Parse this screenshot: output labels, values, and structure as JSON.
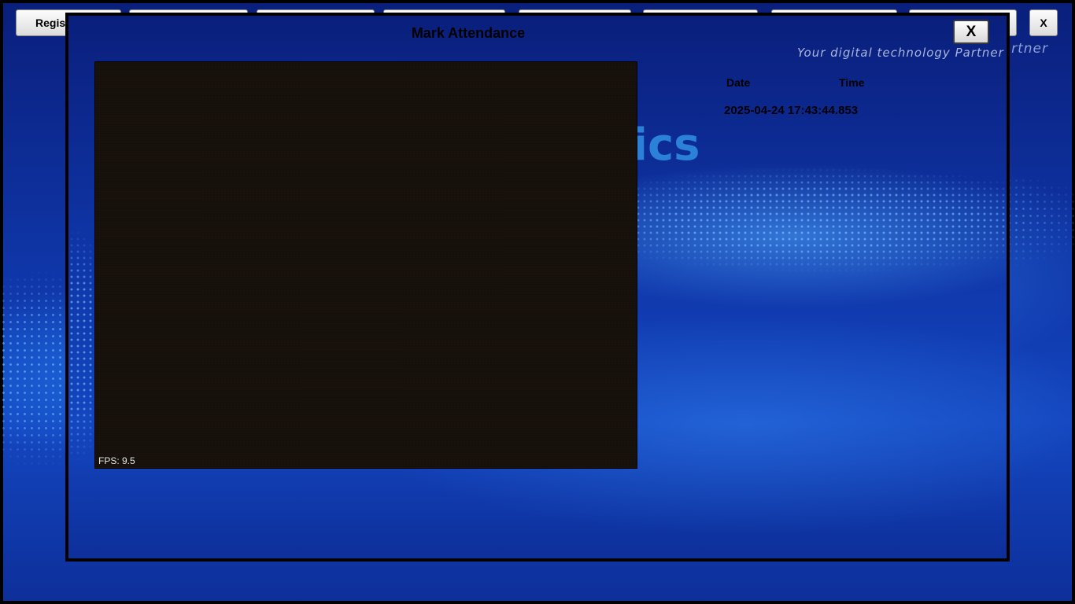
{
  "app": {
    "nav_buttons": [
      {
        "label": "Regist"
      },
      {
        "label": ""
      },
      {
        "label": ""
      },
      {
        "label": ""
      },
      {
        "label": ""
      },
      {
        "label": ""
      },
      {
        "label": ""
      },
      {
        "label": ""
      }
    ],
    "exit_label": "X",
    "tagline": "artner"
  },
  "modal": {
    "title": "Mark Attendance",
    "close_label": "X",
    "tagline": "Your digital technology Partner",
    "brand_fragment": "tics",
    "camera": {
      "fps_text": "FPS: 9.5"
    },
    "date_header": "Date",
    "time_header": "Time",
    "datetime_value": "2025-04-24 17:43:44.853"
  },
  "colors": {
    "background": "#0f36a8",
    "brand_text": "#2b80d8",
    "camera_bg": "#14100c"
  }
}
